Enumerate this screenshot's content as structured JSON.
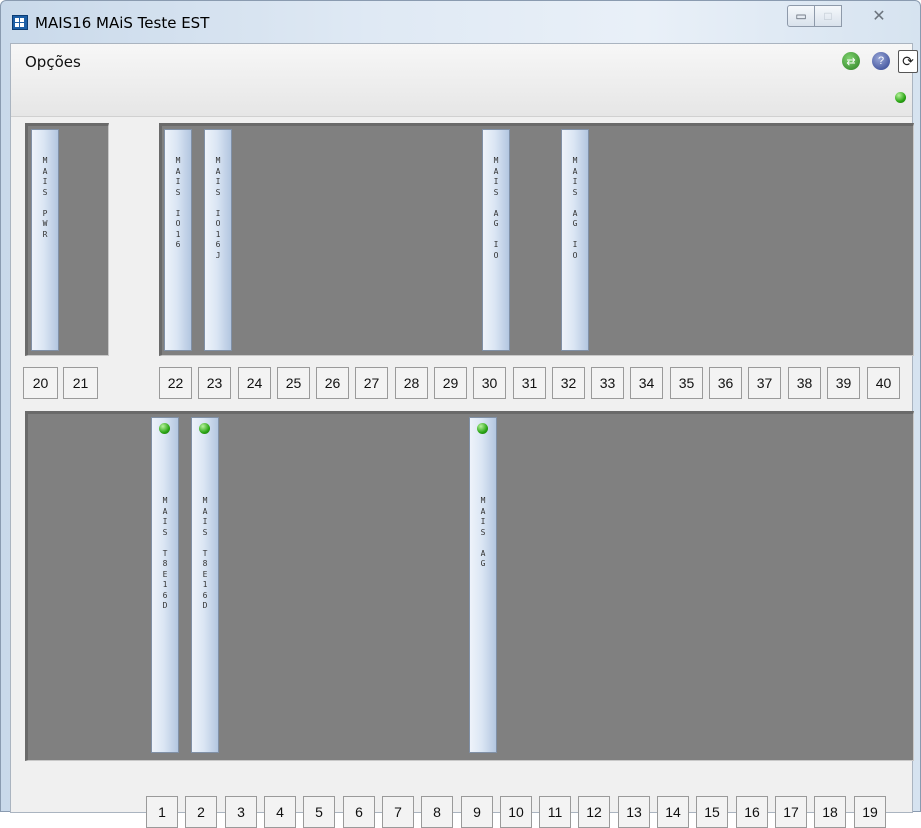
{
  "window": {
    "title": "MAIS16 MAiS Teste EST",
    "controls": {
      "minimize": "▭",
      "maximize": "□",
      "close": "✕"
    }
  },
  "toolbar": {
    "menu_label": "Opções",
    "icons": [
      "network-icon",
      "help-icon",
      "refresh-icon"
    ],
    "status_led_color": "#2aa514"
  },
  "upper_rack": {
    "slots": [
      "20",
      "21",
      "22",
      "23",
      "24",
      "25",
      "26",
      "27",
      "28",
      "29",
      "30",
      "31",
      "32",
      "33",
      "34",
      "35",
      "36",
      "37",
      "38",
      "39",
      "40"
    ],
    "modules": [
      {
        "slot": "20",
        "label": "M\nA\nI\nS\n \nP\nW\nR"
      },
      {
        "slot": "22",
        "label": "M\nA\nI\nS\n \nI\nO\n1\n6"
      },
      {
        "slot": "23",
        "label": "M\nA\nI\nS\n \nI\nO\n1\n6\nJ"
      },
      {
        "slot": "30",
        "label": "M\nA\nI\nS\n \nA\nG\n \nI\nO"
      },
      {
        "slot": "32",
        "label": "M\nA\nI\nS\n \nA\nG\n \nI\nO"
      }
    ]
  },
  "lower_rack": {
    "slots": [
      "1",
      "2",
      "3",
      "4",
      "5",
      "6",
      "7",
      "8",
      "9",
      "10",
      "11",
      "12",
      "13",
      "14",
      "15",
      "16",
      "17",
      "18",
      "19"
    ],
    "modules": [
      {
        "slot": "1",
        "label": "M\nA\nI\nS\n \nT\n8\nE\n1\n6\nD",
        "led": true
      },
      {
        "slot": "2",
        "label": "M\nA\nI\nS\n \nT\n8\nE\n1\n6\nD",
        "led": true
      },
      {
        "slot": "9",
        "label": "M\nA\nI\nS\n \nA\nG",
        "led": true
      }
    ]
  }
}
